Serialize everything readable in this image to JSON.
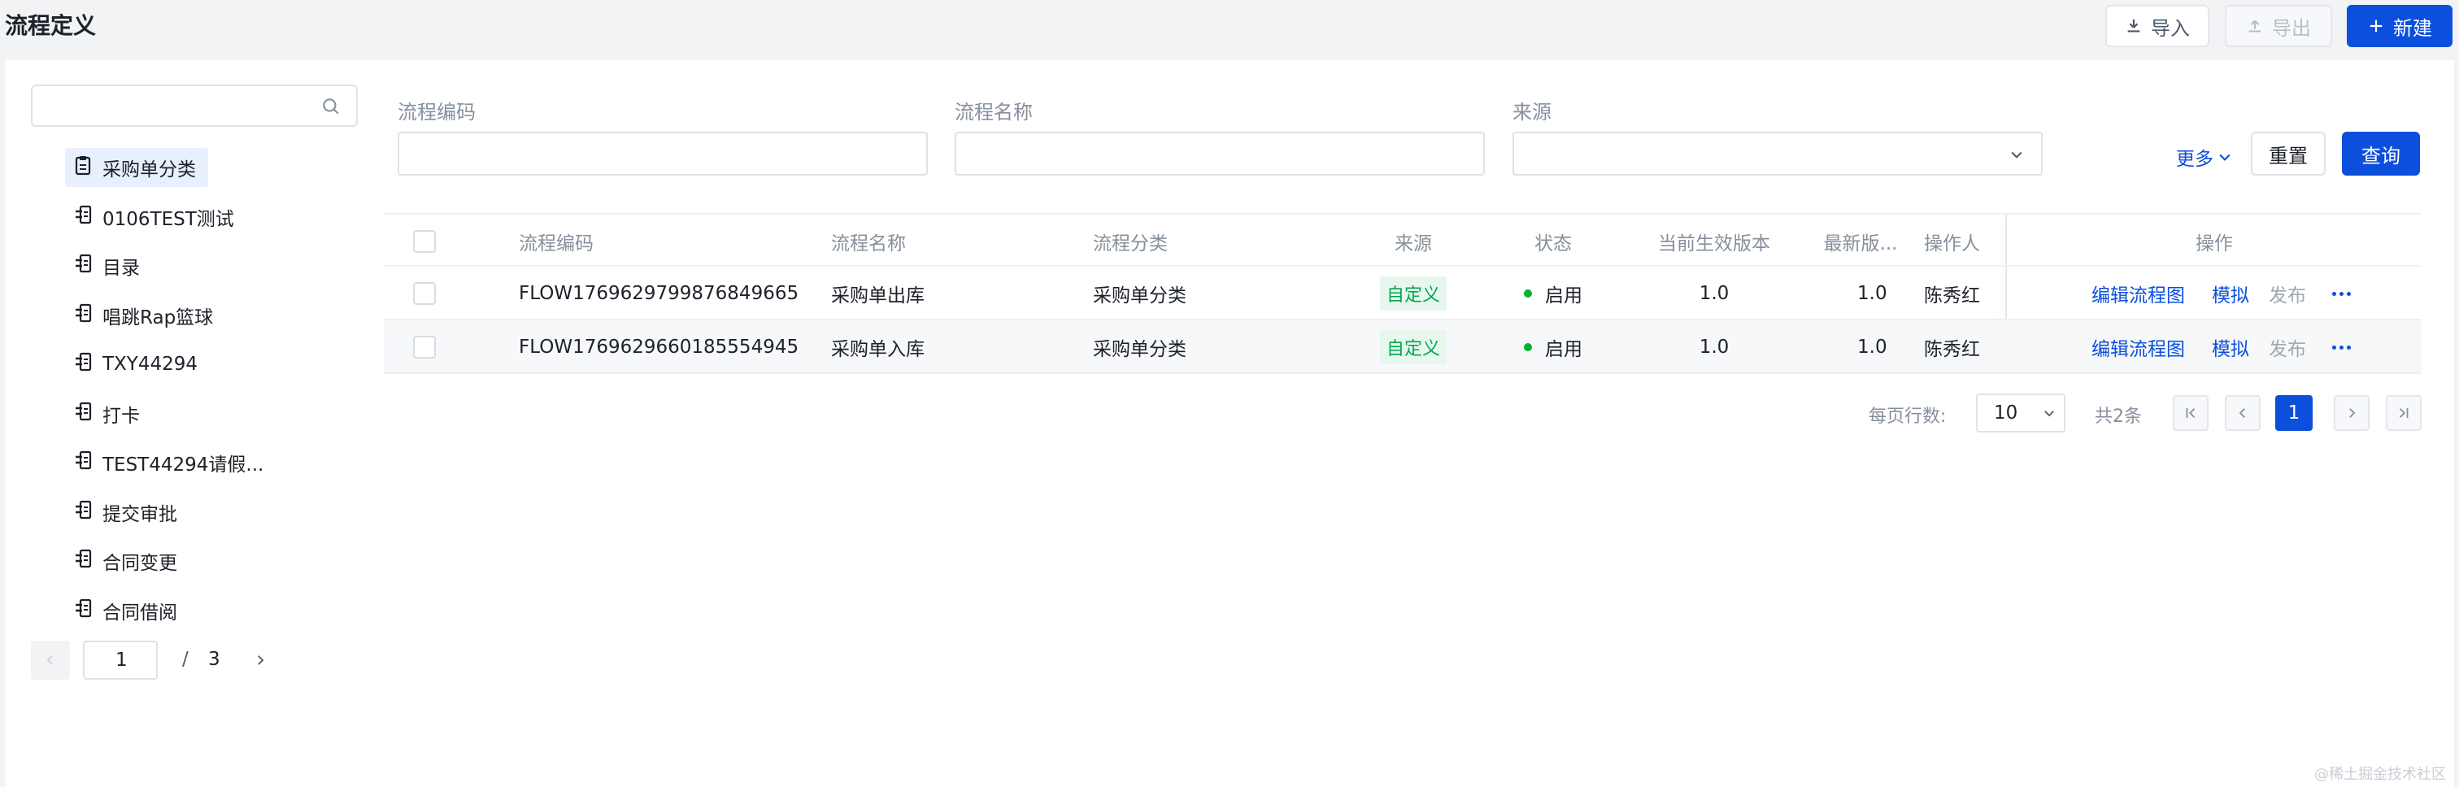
{
  "header": {
    "title": "流程定义",
    "import_label": "导入",
    "export_label": "导出",
    "new_label": "新建"
  },
  "sidebar": {
    "search": {
      "value": "",
      "placeholder": ""
    },
    "items": [
      {
        "label": "采购单分类",
        "icon": "clipboard-icon"
      },
      {
        "label": "0106TEST测试",
        "icon": "flow-doc-icon"
      },
      {
        "label": "目录",
        "icon": "flow-doc-icon"
      },
      {
        "label": "唱跳Rap篮球",
        "icon": "flow-doc-icon"
      },
      {
        "label": "TXY44294",
        "icon": "flow-doc-icon"
      },
      {
        "label": "打卡",
        "icon": "flow-doc-icon"
      },
      {
        "label": "TEST44294请假...",
        "icon": "flow-doc-icon"
      },
      {
        "label": "提交审批",
        "icon": "flow-doc-icon"
      },
      {
        "label": "合同变更",
        "icon": "flow-doc-icon"
      },
      {
        "label": "合同借阅",
        "icon": "flow-doc-icon"
      }
    ],
    "selected_index": 0,
    "pager": {
      "current": "1",
      "slash": "/",
      "total": "3"
    }
  },
  "filters": {
    "code_label": "流程编码",
    "code_value": "",
    "name_label": "流程名称",
    "name_value": "",
    "source_label": "来源",
    "source_value": "",
    "more_label": "更多",
    "reset_label": "重置",
    "query_label": "查询"
  },
  "table": {
    "headers": {
      "code": "流程编码",
      "name": "流程名称",
      "category": "流程分类",
      "source": "来源",
      "status": "状态",
      "current_version": "当前生效版本",
      "latest_version": "最新版...",
      "operator": "操作人",
      "actions": "操作"
    },
    "rows": [
      {
        "code": "FLOW1769629799876849665",
        "name": "采购单出库",
        "category": "采购单分类",
        "source": "自定义",
        "status": "启用",
        "current_version": "1.0",
        "latest_version": "1.0",
        "operator": "陈秀红",
        "action_edit": "编辑流程图",
        "action_simulate": "模拟",
        "action_publish": "发布"
      },
      {
        "code": "FLOW1769629660185554945",
        "name": "采购单入库",
        "category": "采购单分类",
        "source": "自定义",
        "status": "启用",
        "current_version": "1.0",
        "latest_version": "1.0",
        "operator": "陈秀红",
        "action_edit": "编辑流程图",
        "action_simulate": "模拟",
        "action_publish": "发布"
      }
    ]
  },
  "pagination": {
    "page_size_label": "每页行数:",
    "page_size": "10",
    "total_label": "共2条",
    "current_page": "1"
  },
  "watermark": "@稀土掘金技术社区",
  "colors": {
    "primary": "#0b4fdc",
    "success": "#00b42a",
    "tag_bg": "#e8f7ee"
  }
}
